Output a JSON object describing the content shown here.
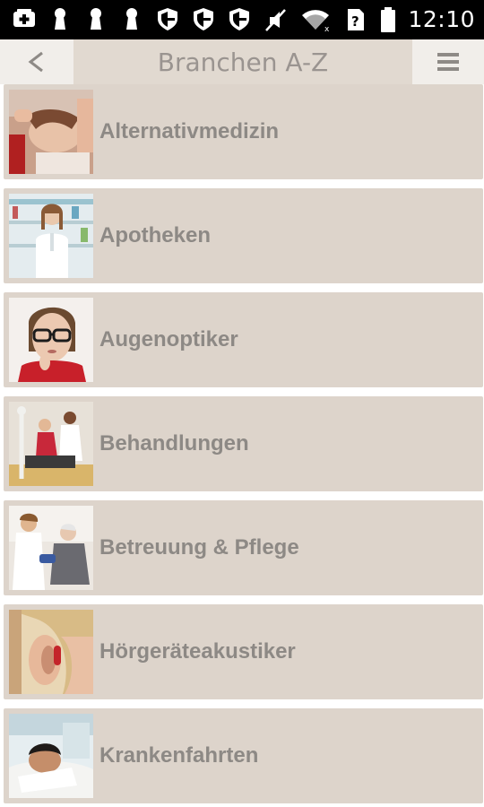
{
  "status_bar": {
    "time": "12:10",
    "icons_left": [
      "add-box-icon",
      "keyhole-icon",
      "keyhole-icon",
      "keyhole-icon",
      "shield-icon",
      "shield-icon",
      "shield-icon"
    ],
    "icons_right": [
      "mute-icon",
      "wifi-icon",
      "no-sim-icon",
      "battery-icon"
    ]
  },
  "header": {
    "title": "Branchen A-Z",
    "back_icon": "chevron-left-icon",
    "menu_icon": "hamburger-menu-icon"
  },
  "colors": {
    "item_background": "#ddd4cb",
    "title_background": "#e1d9d0",
    "label_text": "#8d8985"
  },
  "categories": [
    {
      "label": "Alternativmedizin",
      "icon": "massage-photo"
    },
    {
      "label": "Apotheken",
      "icon": "pharmacist-photo"
    },
    {
      "label": "Augenoptiker",
      "icon": "glasses-woman-photo"
    },
    {
      "label": "Behandlungen",
      "icon": "physiotherapy-photo"
    },
    {
      "label": "Betreuung & Pflege",
      "icon": "elderly-care-photo"
    },
    {
      "label": "Hörgeräteakustiker",
      "icon": "hearing-aid-photo"
    },
    {
      "label": "Krankenfahrten",
      "icon": "patient-transport-photo"
    }
  ]
}
